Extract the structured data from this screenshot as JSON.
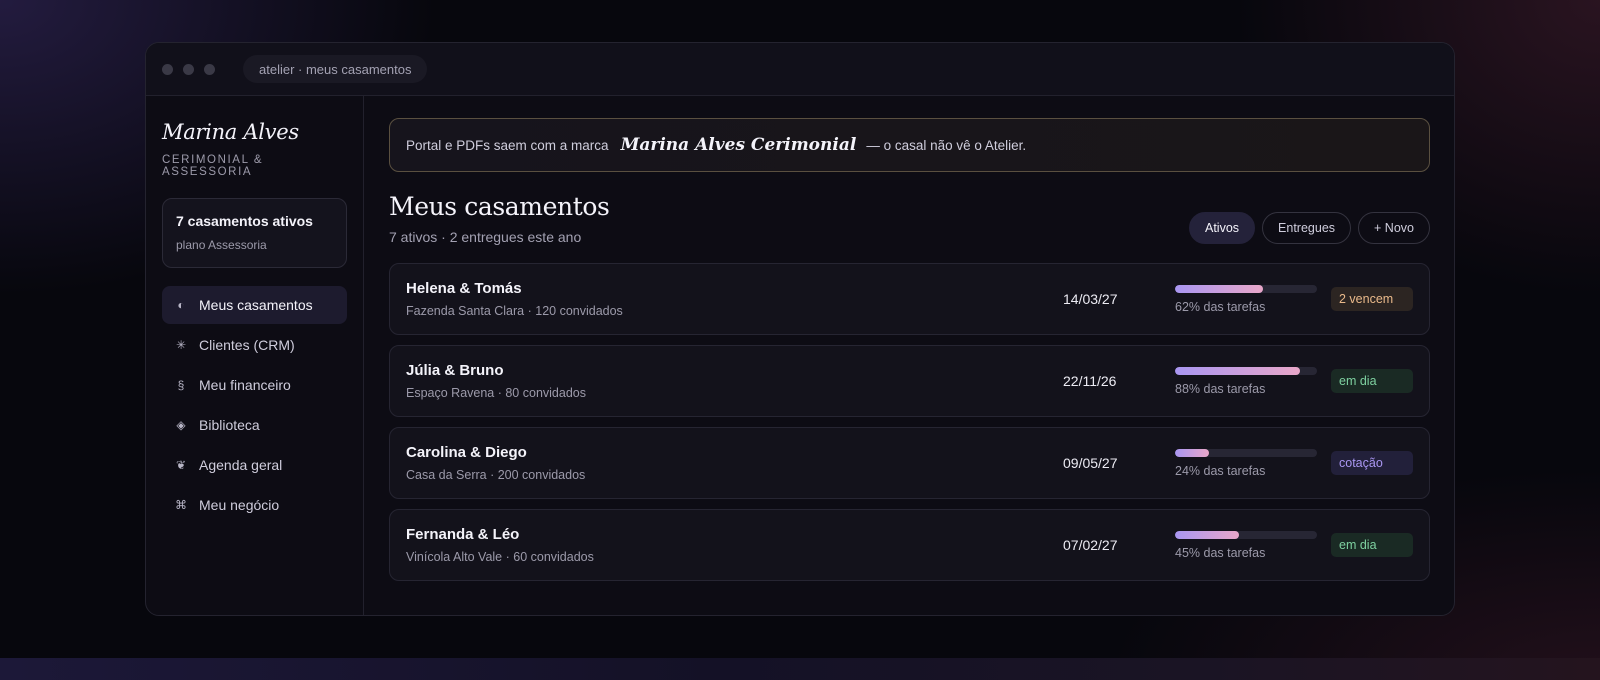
{
  "window": {
    "address": "atelier · meus casamentos"
  },
  "sidebar": {
    "brand_name": "Marina Alves",
    "brand_sub": "CERIMONIAL & ASSESSORIA",
    "plan_title": "7 casamentos ativos",
    "plan_sub": "plano Assessoria",
    "items": [
      {
        "label": "Meus casamentos",
        "icon": "◐",
        "icon_name": "half-circle-icon",
        "active": true
      },
      {
        "label": "Clientes (CRM)",
        "icon": "✳",
        "icon_name": "asterisk-icon",
        "active": false
      },
      {
        "label": "Meu financeiro",
        "icon": "§",
        "icon_name": "section-icon",
        "active": false
      },
      {
        "label": "Biblioteca",
        "icon": "◈",
        "icon_name": "diamond-icon",
        "active": false
      },
      {
        "label": "Agenda geral",
        "icon": "❦",
        "icon_name": "floral-heart-icon",
        "active": false
      },
      {
        "label": "Meu negócio",
        "icon": "⌘",
        "icon_name": "command-icon",
        "active": false
      }
    ]
  },
  "banner": {
    "prefix": "Portal e PDFs saem com a marca",
    "brand": "Marina Alves Cerimonial",
    "suffix": "— o casal não vê o Atelier."
  },
  "header": {
    "title": "Meus casamentos",
    "subtitle": "7 ativos · 2 entregues este ano"
  },
  "filters": [
    {
      "label": "Ativos",
      "active": true
    },
    {
      "label": "Entregues",
      "active": false
    },
    {
      "label": "+ Novo",
      "active": false
    }
  ],
  "weddings": [
    {
      "couple": "Helena & Tomás",
      "venue": "Fazenda Santa Clara · 120 convidados",
      "date": "14/03/27",
      "progress": 62,
      "progress_label": "62% das tarefas",
      "status": "2 vencem",
      "status_fg": "#e9b98a",
      "status_bg": "#2c2522"
    },
    {
      "couple": "Júlia & Bruno",
      "venue": "Espaço Ravena · 80 convidados",
      "date": "22/11/26",
      "progress": 88,
      "progress_label": "88% das tarefas",
      "status": "em dia",
      "status_fg": "#7ed0a0",
      "status_bg": "#1a2a24"
    },
    {
      "couple": "Carolina & Diego",
      "venue": "Casa da Serra · 200 convidados",
      "date": "09/05/27",
      "progress": 24,
      "progress_label": "24% das tarefas",
      "status": "cotação",
      "status_fg": "#a996f2",
      "status_bg": "#22203a"
    },
    {
      "couple": "Fernanda & Léo",
      "venue": "Vinícola Alto Vale · 60 convidados",
      "date": "07/02/27",
      "progress": 45,
      "progress_label": "45% das tarefas",
      "status": "em dia",
      "status_fg": "#7ed0a0",
      "status_bg": "#1a2a24"
    }
  ]
}
